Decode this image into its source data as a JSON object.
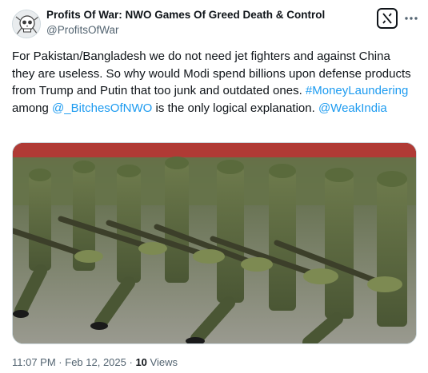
{
  "author": {
    "display_name": "Profits Of War: NWO Games Of Greed Death & Control",
    "handle": "@ProfitsOfWar"
  },
  "tweet": {
    "text_part1": "For Pakistan/Bangladesh we do not need jet fighters and against China they are useless. So why would Modi spend billions upon defense products from Trump and Putin that too junk and outdated ones.",
    "hashtag": "#MoneyLaundering",
    "text_part2": " among ",
    "mention1": "@_BitchesOfNWO",
    "text_part3": " is the only logical explanation. ",
    "mention2": "@WeakIndia"
  },
  "meta": {
    "time": "11:07 PM",
    "separator1": " · ",
    "date": "Feb 12, 2025",
    "separator2": " · ",
    "views_count": "10",
    "views_label": " Views"
  },
  "icons": {
    "grok": "grok-icon",
    "more": "more-icon",
    "avatar": "skull-avatar"
  },
  "colors": {
    "link": "#1d9bf0",
    "text": "#0f1419",
    "secondary": "#536471",
    "border": "#cfd9de"
  }
}
